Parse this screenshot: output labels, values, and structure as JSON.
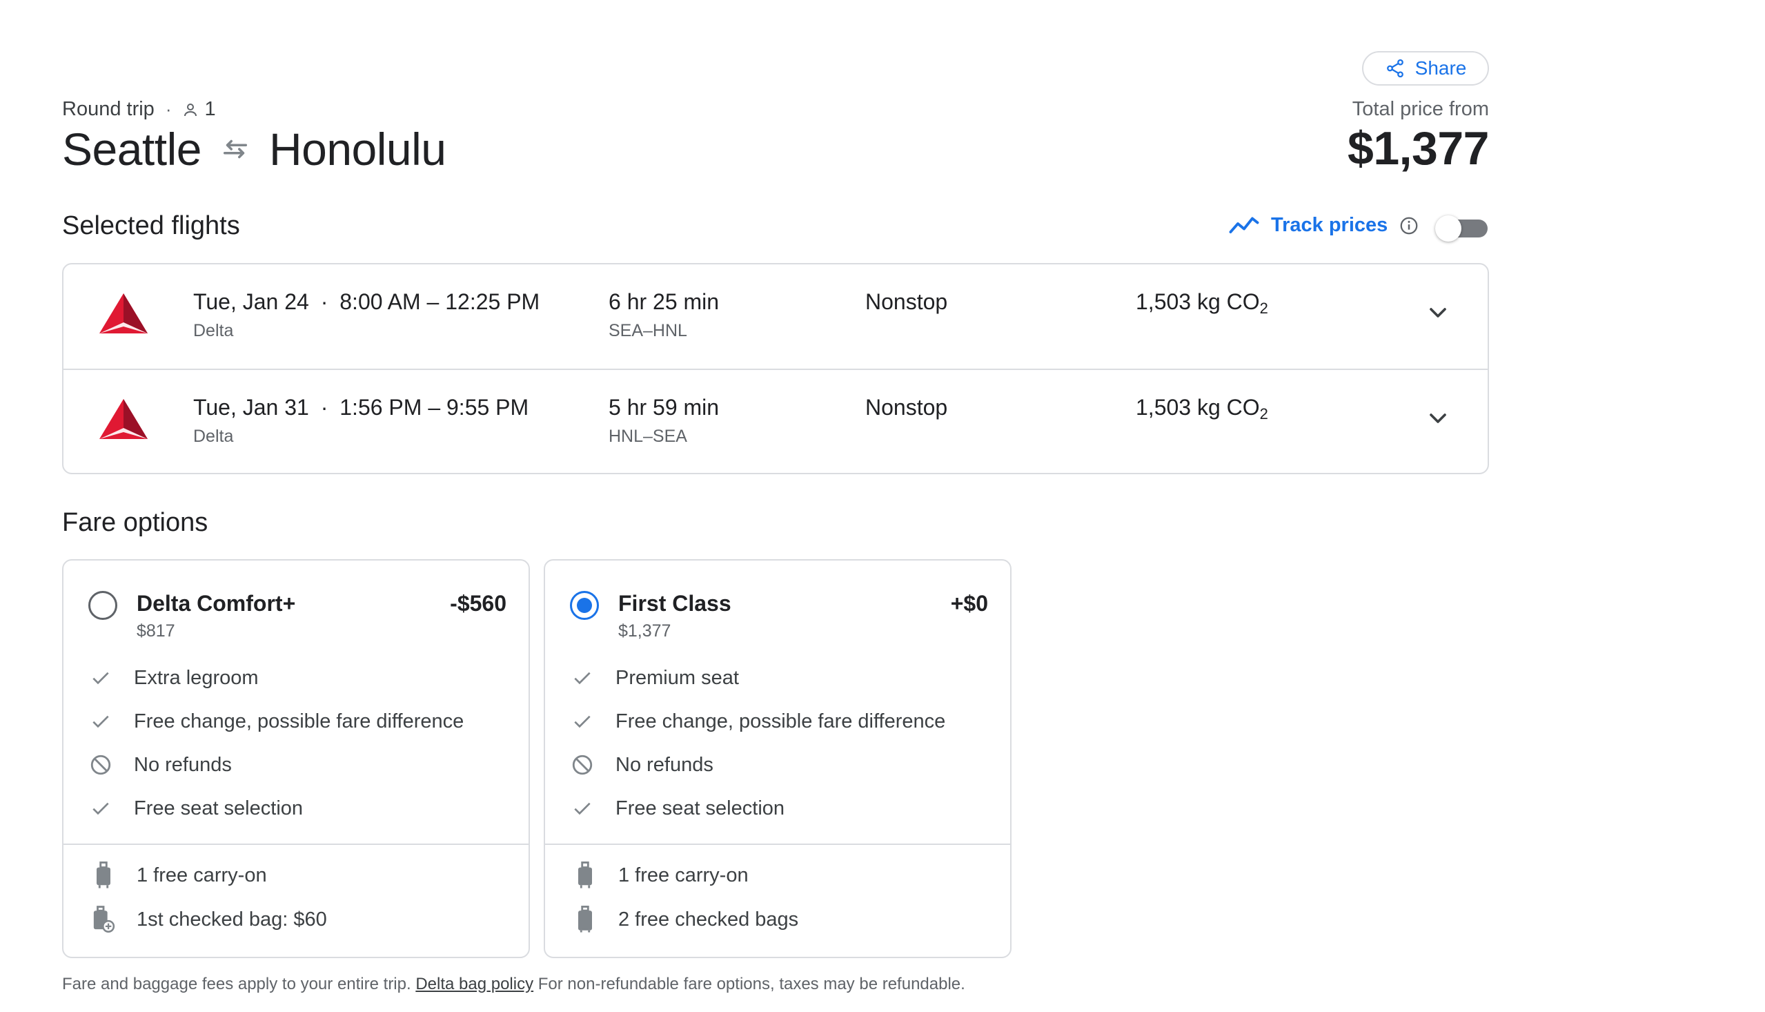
{
  "header": {
    "trip_type": "Round trip",
    "separator": "·",
    "passengers": "1",
    "origin": "Seattle",
    "destination": "Honolulu"
  },
  "price": {
    "share_label": "Share",
    "label": "Total price from",
    "total": "$1,377"
  },
  "selected": {
    "title": "Selected flights",
    "track_label": "Track prices",
    "track_enabled": false
  },
  "flights": [
    {
      "date": "Tue, Jan 24",
      "sep": "·",
      "times": "8:00 AM – 12:25 PM",
      "airline": "Delta",
      "duration": "6 hr 25 min",
      "route": "SEA–HNL",
      "stops": "Nonstop",
      "co2": "1,503 kg CO",
      "co2_sub": "2"
    },
    {
      "date": "Tue, Jan 31",
      "sep": "·",
      "times": "1:56 PM – 9:55 PM",
      "airline": "Delta",
      "duration": "5 hr 59 min",
      "route": "HNL–SEA",
      "stops": "Nonstop",
      "co2": "1,503 kg CO",
      "co2_sub": "2"
    }
  ],
  "fares": {
    "title": "Fare options",
    "options": [
      {
        "name": "Delta Comfort+",
        "price": "$817",
        "diff": "-$560",
        "selected": false,
        "features": [
          "Extra legroom",
          "Free change, possible fare difference",
          "No refunds",
          "Free seat selection"
        ],
        "bags": [
          "1 free carry-on",
          "1st checked bag: $60"
        ]
      },
      {
        "name": "First Class",
        "price": "$1,377",
        "diff": "+$0",
        "selected": true,
        "features": [
          "Premium seat",
          "Free change, possible fare difference",
          "No refunds",
          "Free seat selection"
        ],
        "bags": [
          "1 free carry-on",
          "2 free checked bags"
        ]
      }
    ]
  },
  "footnote": {
    "before": "Fare and baggage fees apply to your entire trip.",
    "link": "Delta bag policy",
    "after": "For non-refundable fare options, taxes may be refundable."
  },
  "colors": {
    "accent": "#1a73e8",
    "delta_red": "#c8102e",
    "text": "#202124",
    "muted": "#5f6368",
    "border": "#dadce0"
  }
}
